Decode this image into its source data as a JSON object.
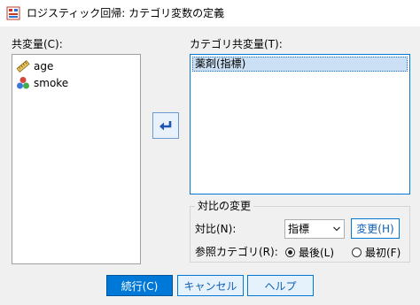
{
  "window": {
    "title": "ロジスティック回帰: カテゴリ変数の定義"
  },
  "covariates": {
    "label": "共変量(C):",
    "items": [
      {
        "label": "age",
        "icon": "ruler-scale-icon"
      },
      {
        "label": "smoke",
        "icon": "nominal-balls-icon"
      }
    ]
  },
  "move_button": {
    "icon": "arrow-left-icon"
  },
  "categorical_covariates": {
    "label": "カテゴリ共変量(T):",
    "items": [
      {
        "label": "薬剤(指標)"
      }
    ]
  },
  "change_contrast": {
    "group_title": "対比の変更",
    "contrast_label": "対比(N):",
    "contrast_value": "指標",
    "change_button": "変更(H)",
    "reference_label": "参照カテゴリ(R):",
    "options": [
      {
        "label": "最後(L)",
        "selected": true
      },
      {
        "label": "最初(F)",
        "selected": false
      }
    ]
  },
  "footer": {
    "continue": "続行(C)",
    "cancel": "キャンセル",
    "help": "ヘルプ"
  },
  "colors": {
    "accent": "#0078d7",
    "selection": "#cce0f5"
  }
}
